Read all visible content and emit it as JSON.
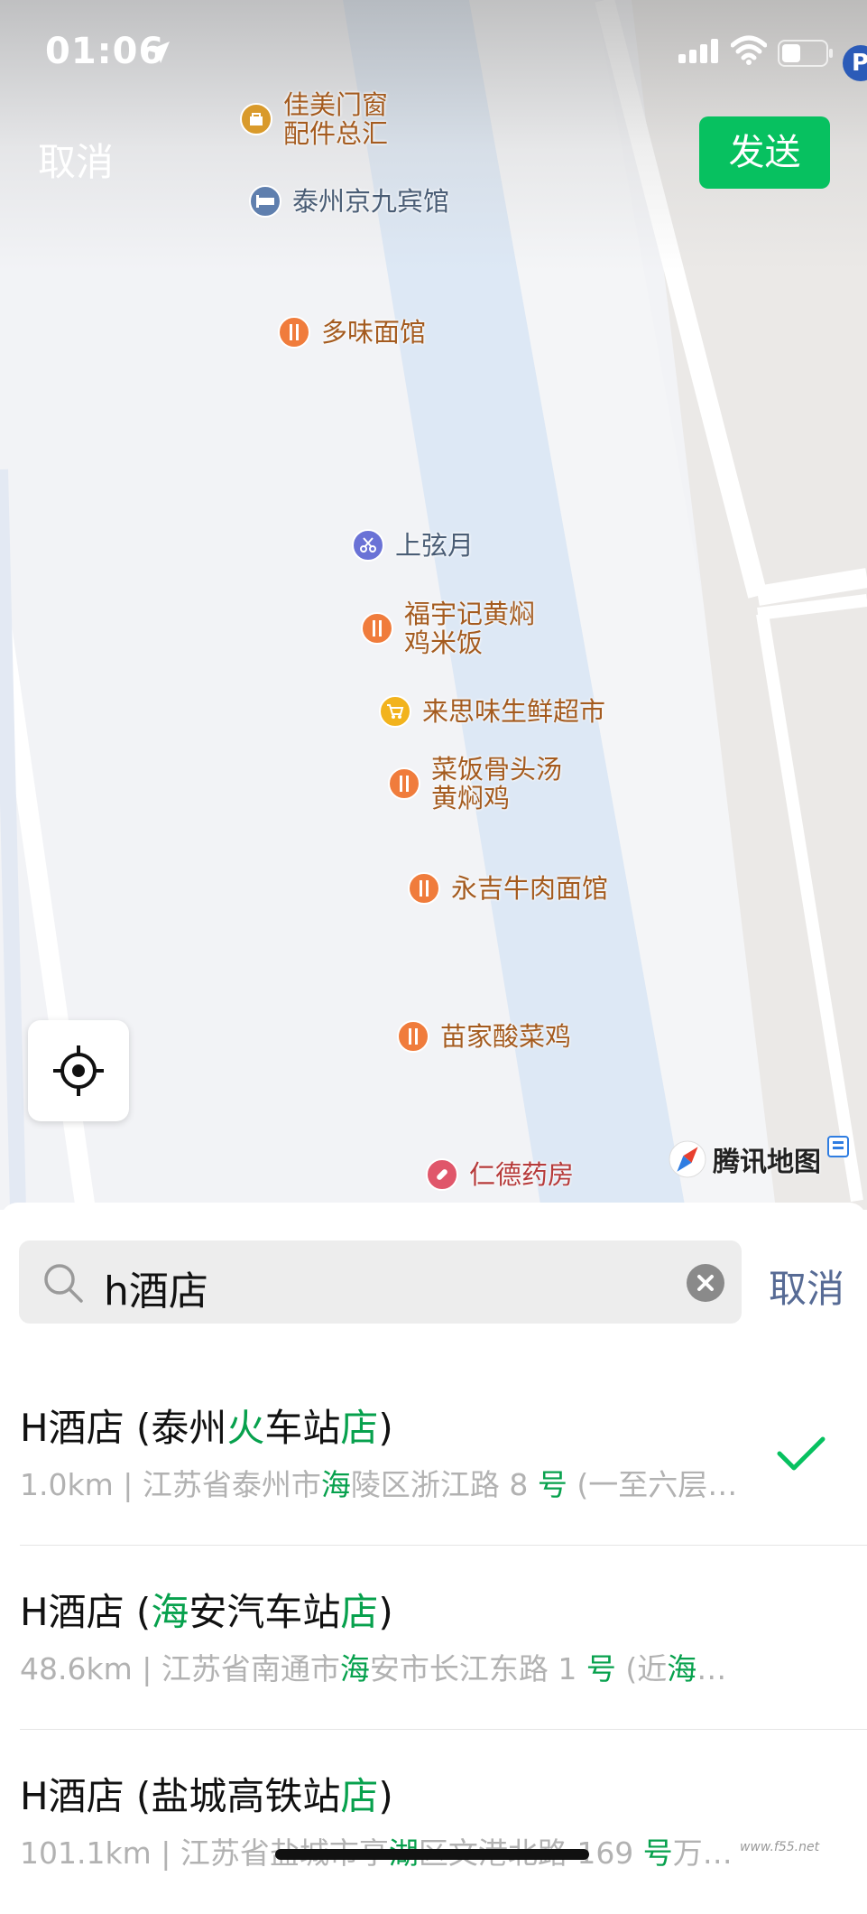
{
  "status_bar": {
    "time": "01:06",
    "icons": [
      "location-arrow-icon",
      "signal-icon",
      "wifi-icon",
      "battery-icon"
    ],
    "badge": "P"
  },
  "header": {
    "cancel_label": "取消",
    "send_label": "发送"
  },
  "map": {
    "pois": [
      {
        "label": "佳美门窗\n配件总汇",
        "icon": "shop-icon",
        "color": "#d99a2b"
      },
      {
        "label": "泰州京九宾馆",
        "icon": "hotel-icon",
        "color": "#5f7fae"
      },
      {
        "label": "多味面馆",
        "icon": "restaurant-icon",
        "color": "#f07c3c"
      },
      {
        "label": "上弦月",
        "icon": "scissors-icon",
        "color": "#6a72d6"
      },
      {
        "label": "福宇记黄焖\n鸡米饭",
        "icon": "restaurant-icon",
        "color": "#f07c3c"
      },
      {
        "label": "来思味生鲜超市",
        "icon": "cart-icon",
        "color": "#f2b31d"
      },
      {
        "label": "菜饭骨头汤\n黄焖鸡",
        "icon": "restaurant-icon",
        "color": "#f07c3c"
      },
      {
        "label": "永吉牛肉面馆",
        "icon": "restaurant-icon",
        "color": "#f07c3c"
      },
      {
        "label": "苗家酸菜鸡",
        "icon": "restaurant-icon",
        "color": "#f07c3c"
      },
      {
        "label": "仁德药房",
        "icon": "pill-icon",
        "color": "#e0566a"
      }
    ],
    "logo_text": "腾讯地图"
  },
  "search": {
    "query": "h酒店",
    "cancel_label": "取消"
  },
  "results": [
    {
      "title": [
        {
          "t": "H酒店 (泰州",
          "h": false
        },
        {
          "t": "火",
          "h": true
        },
        {
          "t": "车站",
          "h": false
        },
        {
          "t": "店",
          "h": true
        },
        {
          "t": ")",
          "h": false
        }
      ],
      "subtitle": [
        {
          "t": "1.0km | 江苏省泰州市",
          "h": false
        },
        {
          "t": "海",
          "h": true
        },
        {
          "t": "陵区浙江路 8 ",
          "h": false
        },
        {
          "t": "号",
          "h": true
        },
        {
          "t": " (一至六层…",
          "h": false
        }
      ],
      "selected": true
    },
    {
      "title": [
        {
          "t": "H酒店 (",
          "h": false
        },
        {
          "t": "海",
          "h": true
        },
        {
          "t": "安汽车站",
          "h": false
        },
        {
          "t": "店",
          "h": true
        },
        {
          "t": ")",
          "h": false
        }
      ],
      "subtitle": [
        {
          "t": "48.6km | 江苏省南通市",
          "h": false
        },
        {
          "t": "海",
          "h": true
        },
        {
          "t": "安市长江东路 1 ",
          "h": false
        },
        {
          "t": "号",
          "h": true
        },
        {
          "t": " (近",
          "h": false
        },
        {
          "t": "海",
          "h": true
        },
        {
          "t": "…",
          "h": false
        }
      ],
      "selected": false
    },
    {
      "title": [
        {
          "t": "H酒店 (盐城高铁站",
          "h": false
        },
        {
          "t": "店",
          "h": true
        },
        {
          "t": ")",
          "h": false
        }
      ],
      "subtitle": [
        {
          "t": "101.1km | 江苏省盐城市亭",
          "h": false
        },
        {
          "t": "湖",
          "h": true
        },
        {
          "t": "区文港北路 169 ",
          "h": false
        },
        {
          "t": "号",
          "h": true
        },
        {
          "t": "万…",
          "h": false
        }
      ],
      "selected": false
    }
  ],
  "accent_color": "#07c160",
  "watermark": "www.f55.net"
}
